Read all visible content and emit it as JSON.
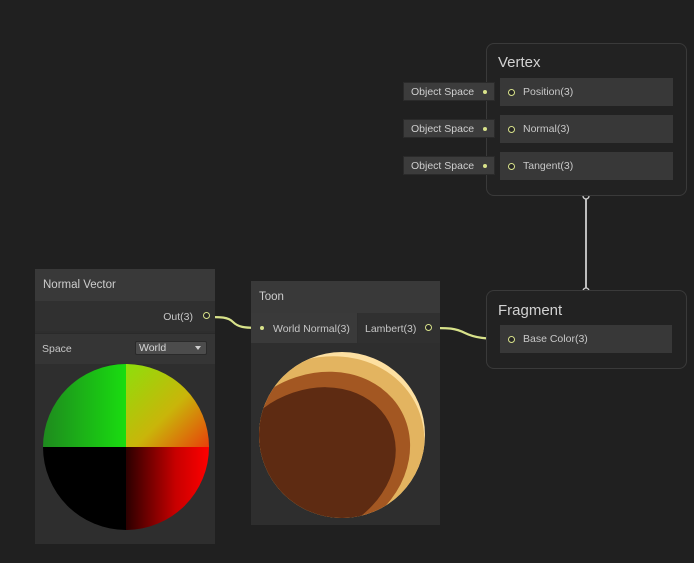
{
  "vertex": {
    "title": "Vertex",
    "slots": [
      {
        "input": "Object Space",
        "label": "Position(3)"
      },
      {
        "input": "Object Space",
        "label": "Normal(3)"
      },
      {
        "input": "Object Space",
        "label": "Tangent(3)"
      }
    ]
  },
  "fragment": {
    "title": "Fragment",
    "slots": [
      {
        "label": "Base Color(3)"
      }
    ]
  },
  "normal_vector": {
    "title": "Normal Vector",
    "output_label": "Out(3)",
    "space_label": "Space",
    "space_value": "World"
  },
  "toon": {
    "title": "Toon",
    "input_label": "World Normal(3)",
    "output_label": "Lambert(3)"
  },
  "colors": {
    "background": "#202020",
    "wire_vector3": "#d8e28a",
    "wire_flow": "#bdbdbd",
    "toon_dark": "#5e2b12",
    "toon_mid": "#a35722",
    "toon_light": "#e3b460",
    "toon_highlight": "#fde0a2"
  }
}
